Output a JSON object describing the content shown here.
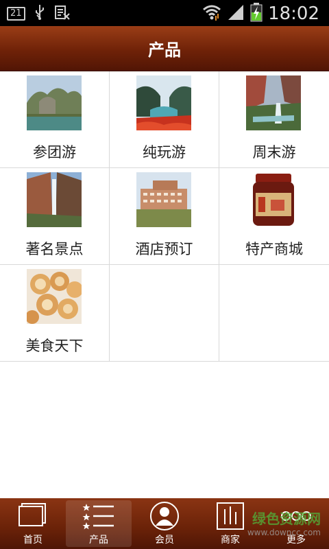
{
  "status_bar": {
    "notification_badge": "21",
    "time": "18:02",
    "icons": [
      "usb-icon",
      "keyboard-icon",
      "wifi-icon",
      "signal-icon",
      "battery-charging-icon"
    ]
  },
  "header": {
    "title": "产品"
  },
  "grid": {
    "items": [
      {
        "label": "参团游",
        "image": "mountain-river-photo"
      },
      {
        "label": "纯玩游",
        "image": "gorge-river-photo"
      },
      {
        "label": "周末游",
        "image": "waterfall-cliff-photo"
      },
      {
        "label": "著名景点",
        "image": "waterfall-photo"
      },
      {
        "label": "酒店预订",
        "image": "hotel-building-photo"
      },
      {
        "label": "特产商城",
        "image": "jar-product-photo"
      },
      {
        "label": "美食天下",
        "image": "pastry-food-photo"
      }
    ]
  },
  "tab_bar": {
    "tabs": [
      {
        "label": "首页",
        "icon": "home-icon",
        "active": false
      },
      {
        "label": "产品",
        "icon": "list-icon",
        "active": true
      },
      {
        "label": "会员",
        "icon": "member-icon",
        "active": false
      },
      {
        "label": "商家",
        "icon": "merchant-icon",
        "active": false
      },
      {
        "label": "更多",
        "icon": "more-icon",
        "active": false
      }
    ]
  },
  "watermark": {
    "text": "绿色资源网",
    "sub": "www.downcc.com"
  },
  "colors": {
    "header_brown": "#6f2208",
    "grid_line": "#d8d8d8",
    "tab_active": "#8d4a30"
  }
}
